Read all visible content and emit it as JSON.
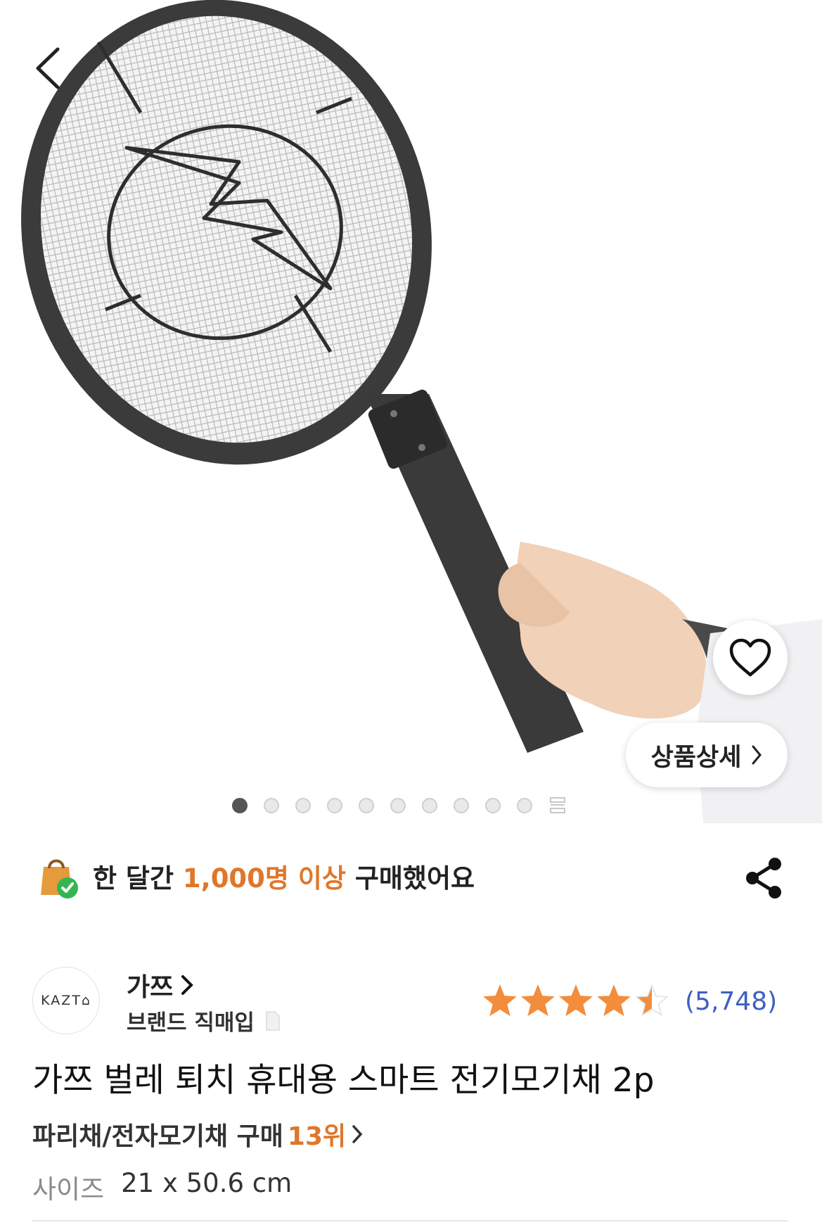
{
  "gallery": {
    "detail_button_label": "상품상세",
    "total_images": 10,
    "active_index": 0
  },
  "purchase_banner": {
    "prefix": "한 달간 ",
    "highlight": "1,000명 이상",
    "suffix": " 구매했어요",
    "highlight_color": "#e0762b"
  },
  "brand": {
    "logo_text": "KAZT⌂",
    "name": "가쯔",
    "subtitle": "브랜드 직매입"
  },
  "rating": {
    "stars": 4.5,
    "max": 5,
    "review_count": "(5,748)",
    "star_color": "#f38d3c",
    "count_color": "#3e5ec2"
  },
  "product": {
    "title": "가쯔 벌레 퇴치 휴대용 스마트 전기모기채 2p",
    "rank_category": "파리채/전자모기채 구매 ",
    "rank_number": "13위",
    "size_label": "사이즈",
    "size_value": "21 x 50.6 cm"
  }
}
